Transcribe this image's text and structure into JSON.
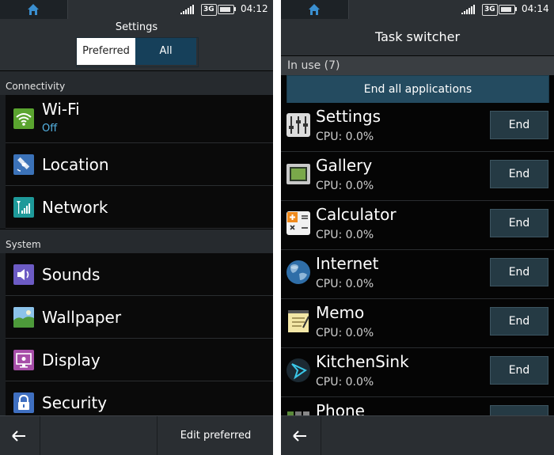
{
  "left": {
    "status": {
      "network": "3G",
      "time": "04:12"
    },
    "title": "Settings",
    "segments": {
      "preferred": "Preferred",
      "all": "All"
    },
    "sections": [
      {
        "title": "Connectivity",
        "items": [
          {
            "label": "Wi-Fi",
            "sub": "Off",
            "icon": "wifi-icon"
          },
          {
            "label": "Location",
            "icon": "satellite-icon"
          },
          {
            "label": "Network",
            "icon": "signal-icon"
          }
        ]
      },
      {
        "title": "System",
        "items": [
          {
            "label": "Sounds",
            "icon": "speaker-icon"
          },
          {
            "label": "Wallpaper",
            "icon": "landscape-icon"
          },
          {
            "label": "Display",
            "icon": "monitor-icon"
          },
          {
            "label": "Security",
            "icon": "lock-icon"
          }
        ]
      }
    ],
    "bottom": {
      "edit_preferred": "Edit preferred"
    }
  },
  "right": {
    "status": {
      "network": "3G",
      "time": "04:14"
    },
    "title": "Task switcher",
    "in_use": "In use (7)",
    "end_all": "End all applications",
    "apps": [
      {
        "name": "Settings",
        "cpu": "CPU: 0.0%",
        "end": "End",
        "icon": "equalizer-icon"
      },
      {
        "name": "Gallery",
        "cpu": "CPU: 0.0%",
        "end": "End",
        "icon": "gallery-icon"
      },
      {
        "name": "Calculator",
        "cpu": "CPU: 0.0%",
        "end": "End",
        "icon": "calculator-icon"
      },
      {
        "name": "Internet",
        "cpu": "CPU: 0.0%",
        "end": "End",
        "icon": "globe-icon"
      },
      {
        "name": "Memo",
        "cpu": "CPU: 0.0%",
        "end": "End",
        "icon": "memo-icon"
      },
      {
        "name": "KitchenSink",
        "cpu": "CPU: 0.0%",
        "end": "End",
        "icon": "kitchensink-icon"
      },
      {
        "name": "Phone",
        "cpu": "",
        "end": "",
        "icon": "phone-icon"
      }
    ]
  },
  "colors": {
    "accent": "#55b4e6",
    "header": "#2c3034",
    "segment_selected": "#16405a",
    "end_button": "#253a44"
  }
}
